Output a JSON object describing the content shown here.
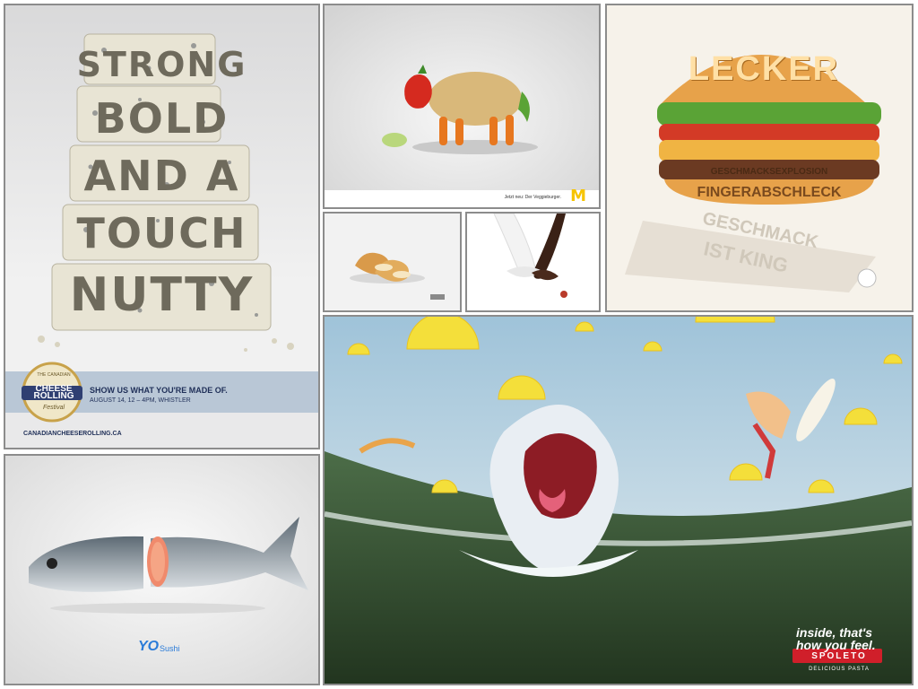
{
  "collage": {
    "cheese": {
      "headline_lines": [
        "STRONG",
        "BOLD",
        "AND A",
        "TOUCH",
        "NUTTY"
      ],
      "logo_small": "THE CANADIAN",
      "logo_main_1": "CHEESE",
      "logo_main_2": "ROLLING",
      "logo_sub": "Festival",
      "tagline": "SHOW US WHAT YOU'RE MADE OF.",
      "date": "AUGUST 14, 12 – 4PM, WHISTLER",
      "url": "CANADIANCHEESEROLLING.CA"
    },
    "veggie": {
      "caption": "Jetzt neu: Der Veggieburger.",
      "logo": "M"
    },
    "burger": {
      "title": "LECKER",
      "words": [
        "FINGERABSCHLECK",
        "GESCHMACKSEXPLOSION"
      ],
      "shadow_words": [
        "GESCHMACK",
        "IST KING"
      ]
    },
    "bread": {},
    "milk": {},
    "fish": {
      "logo": "YO",
      "logo_suffix": "Sushi"
    },
    "shark": {
      "tagline_1": "inside, that's",
      "tagline_2": "how you feel.",
      "brand": "SPOLETO",
      "brand_sub": "DELICIOUS PASTA"
    }
  },
  "colors": {
    "tile_border": "#8c8c8c",
    "cheese_band": "#b9c7d6",
    "spoleto_red": "#d01f2a",
    "mcd_yellow": "#f6c400",
    "sea_green": "#3b5a38"
  }
}
